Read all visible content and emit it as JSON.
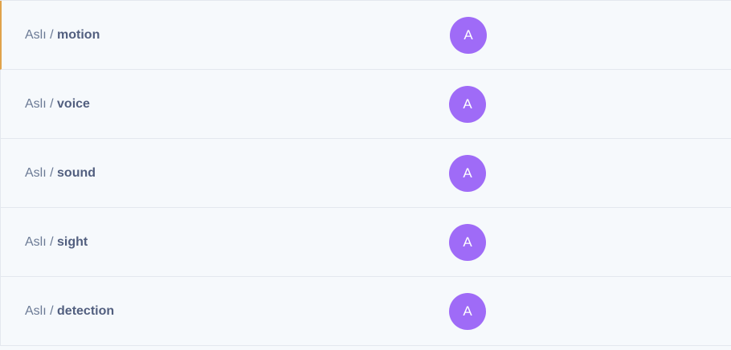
{
  "rows": [
    {
      "prefix": "Aslı",
      "separator": "/",
      "topic": "motion",
      "avatar_letter": "A",
      "active": true
    },
    {
      "prefix": "Aslı",
      "separator": "/",
      "topic": "voice",
      "avatar_letter": "A",
      "active": false
    },
    {
      "prefix": "Aslı",
      "separator": "/",
      "topic": "sound",
      "avatar_letter": "A",
      "active": false
    },
    {
      "prefix": "Aslı",
      "separator": "/",
      "topic": "sight",
      "avatar_letter": "A",
      "active": false
    },
    {
      "prefix": "Aslı",
      "separator": "/",
      "topic": "detection",
      "avatar_letter": "A",
      "active": false
    }
  ],
  "colors": {
    "background": "#f6f9fc",
    "border": "#e3e8ee",
    "active_indicator": "#e0a24b",
    "avatar": "#9f6bf7",
    "text": "#525f7f"
  }
}
